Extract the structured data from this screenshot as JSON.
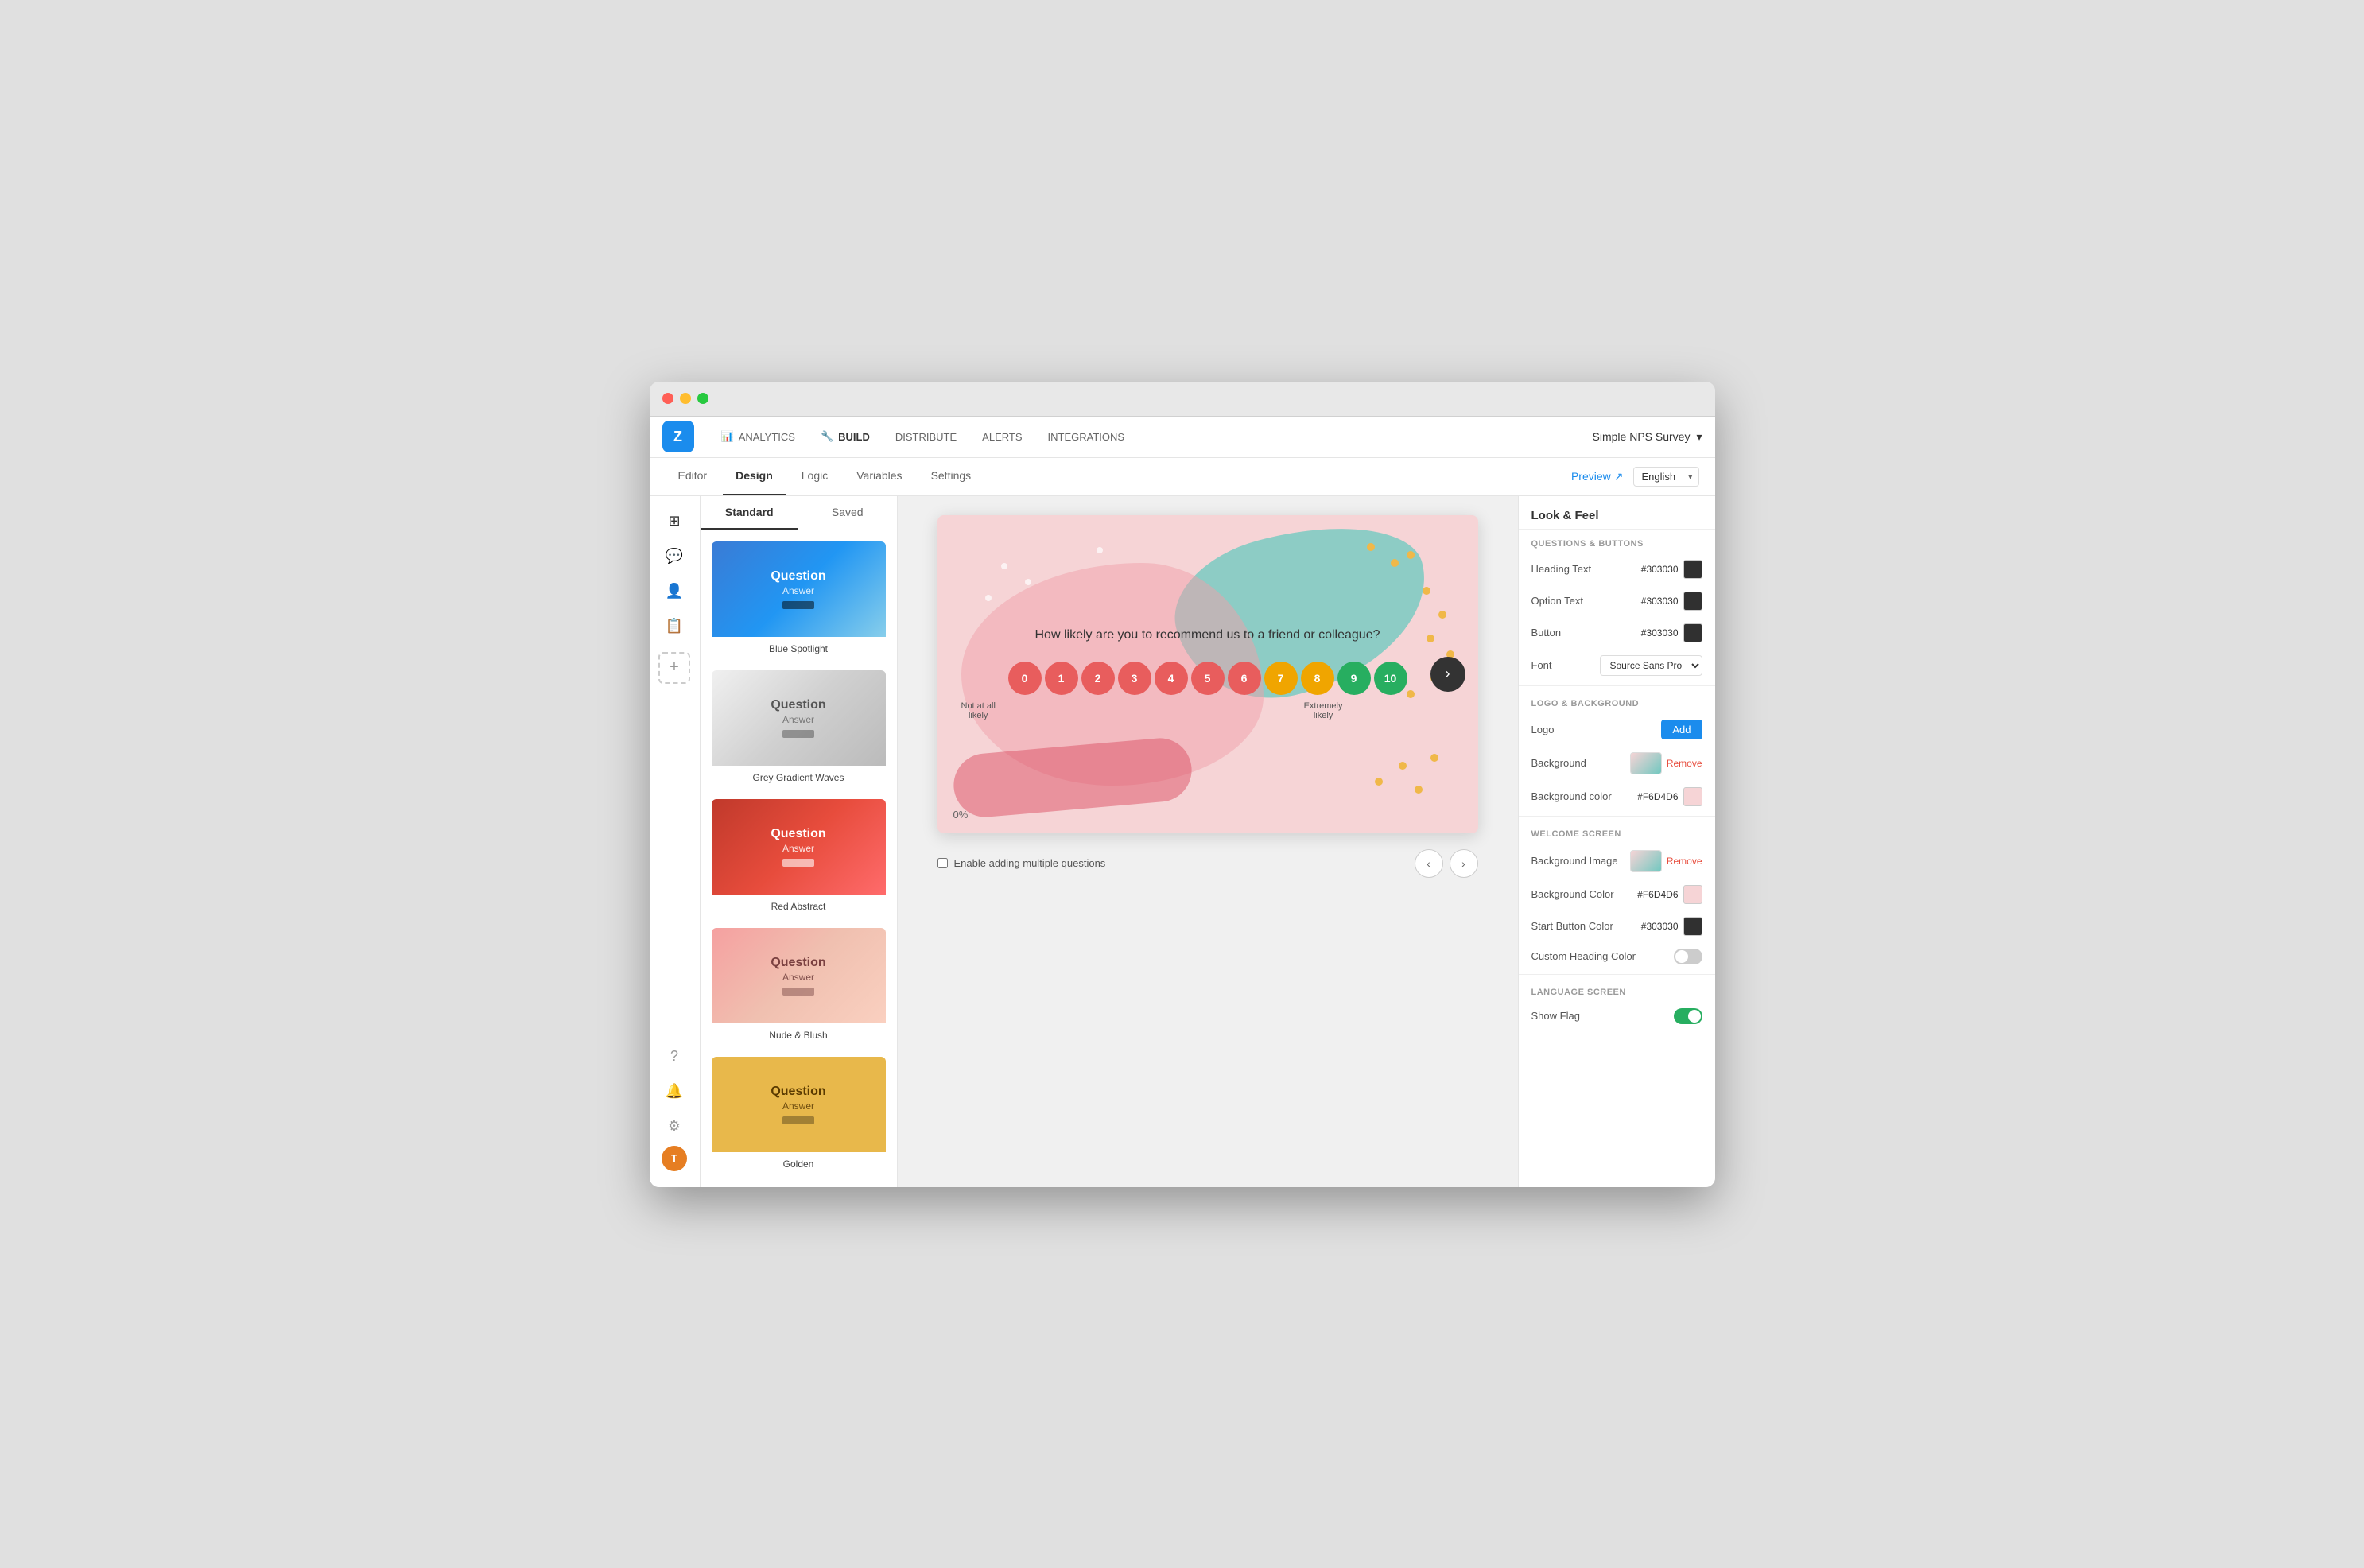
{
  "window": {
    "title": "Simple NPS Survey"
  },
  "titlebar": {
    "dots": [
      "red",
      "yellow",
      "green"
    ]
  },
  "topnav": {
    "logo": "Z",
    "items": [
      {
        "label": "ANALYTICS",
        "icon": "📊",
        "active": false
      },
      {
        "label": "BUILD",
        "icon": "🔧",
        "active": true
      },
      {
        "label": "DISTRIBUTE",
        "active": false
      },
      {
        "label": "ALERTS",
        "active": false
      },
      {
        "label": "INTEGRATIONS",
        "active": false
      }
    ],
    "survey_name": "Simple NPS Survey",
    "dropdown_icon": "▾"
  },
  "subnav": {
    "items": [
      {
        "label": "Editor",
        "active": false
      },
      {
        "label": "Design",
        "active": true
      },
      {
        "label": "Logic",
        "active": false
      },
      {
        "label": "Variables",
        "active": false
      },
      {
        "label": "Settings",
        "active": false
      }
    ],
    "preview_label": "Preview",
    "language": "English"
  },
  "sidebar_icons": {
    "icons": [
      "⊞",
      "💬",
      "👤",
      "📋"
    ],
    "bottom": [
      "?",
      "🔔",
      "⚙"
    ],
    "avatar": "T"
  },
  "themes": {
    "tabs": [
      {
        "label": "Standard",
        "active": true
      },
      {
        "label": "Saved",
        "active": false
      }
    ],
    "items": [
      {
        "name": "Blue Spotlight",
        "style": "blue-spotlight",
        "question": "Question",
        "answer": "Answer",
        "selected": false
      },
      {
        "name": "Grey Gradient Waves",
        "style": "grey-waves",
        "question": "Question",
        "answer": "Answer",
        "selected": false
      },
      {
        "name": "Red Abstract",
        "style": "red-abstract",
        "question": "Question",
        "answer": "Answer",
        "selected": false
      },
      {
        "name": "Nude & Blush",
        "style": "nude-blush",
        "question": "Question",
        "answer": "Answer",
        "selected": false
      },
      {
        "name": "Golden",
        "style": "golden",
        "question": "Question",
        "answer": "Answer",
        "selected": false
      }
    ]
  },
  "survey": {
    "question": "How likely are you to recommend us to a friend or colleague?",
    "nps_buttons": [
      "0",
      "1",
      "2",
      "3",
      "4",
      "5",
      "6",
      "7",
      "8",
      "9",
      "10"
    ],
    "label_left": "Not at all\nlikely",
    "label_right": "Extremely\nlikely",
    "progress": "0%",
    "checkbox_label": "Enable adding multiple questions",
    "checkbox_checked": false
  },
  "look_feel": {
    "title": "Look & Feel",
    "sections": {
      "questions_buttons": {
        "title": "QUESTIONS & BUTTONS",
        "rows": [
          {
            "label": "Heading Text",
            "hex": "#303030",
            "color": "#303030"
          },
          {
            "label": "Option Text",
            "hex": "#303030",
            "color": "#303030"
          },
          {
            "label": "Button",
            "hex": "#303030",
            "color": "#303030"
          },
          {
            "label": "Font",
            "value": "Source Sans Pro"
          }
        ]
      },
      "logo_background": {
        "title": "LOGO & BACKGROUND",
        "rows": [
          {
            "label": "Logo",
            "action": "Add"
          },
          {
            "label": "Background",
            "action": "Remove"
          },
          {
            "label": "Background color",
            "hex": "#F6D4D6",
            "color": "#F6D4D6"
          }
        ]
      },
      "welcome_screen": {
        "title": "WELCOME SCREEN",
        "rows": [
          {
            "label": "Background Image",
            "action": "Remove"
          },
          {
            "label": "Background Color",
            "hex": "#F6D4D6",
            "color": "#F6D4D6"
          },
          {
            "label": "Start Button Color",
            "hex": "#303030",
            "color": "#303030"
          },
          {
            "label": "Custom Heading Color",
            "toggle": "off"
          }
        ]
      },
      "language_screen": {
        "title": "LANGUAGE SCREEN",
        "rows": [
          {
            "label": "Show Flag",
            "toggle": "on"
          }
        ]
      }
    }
  }
}
